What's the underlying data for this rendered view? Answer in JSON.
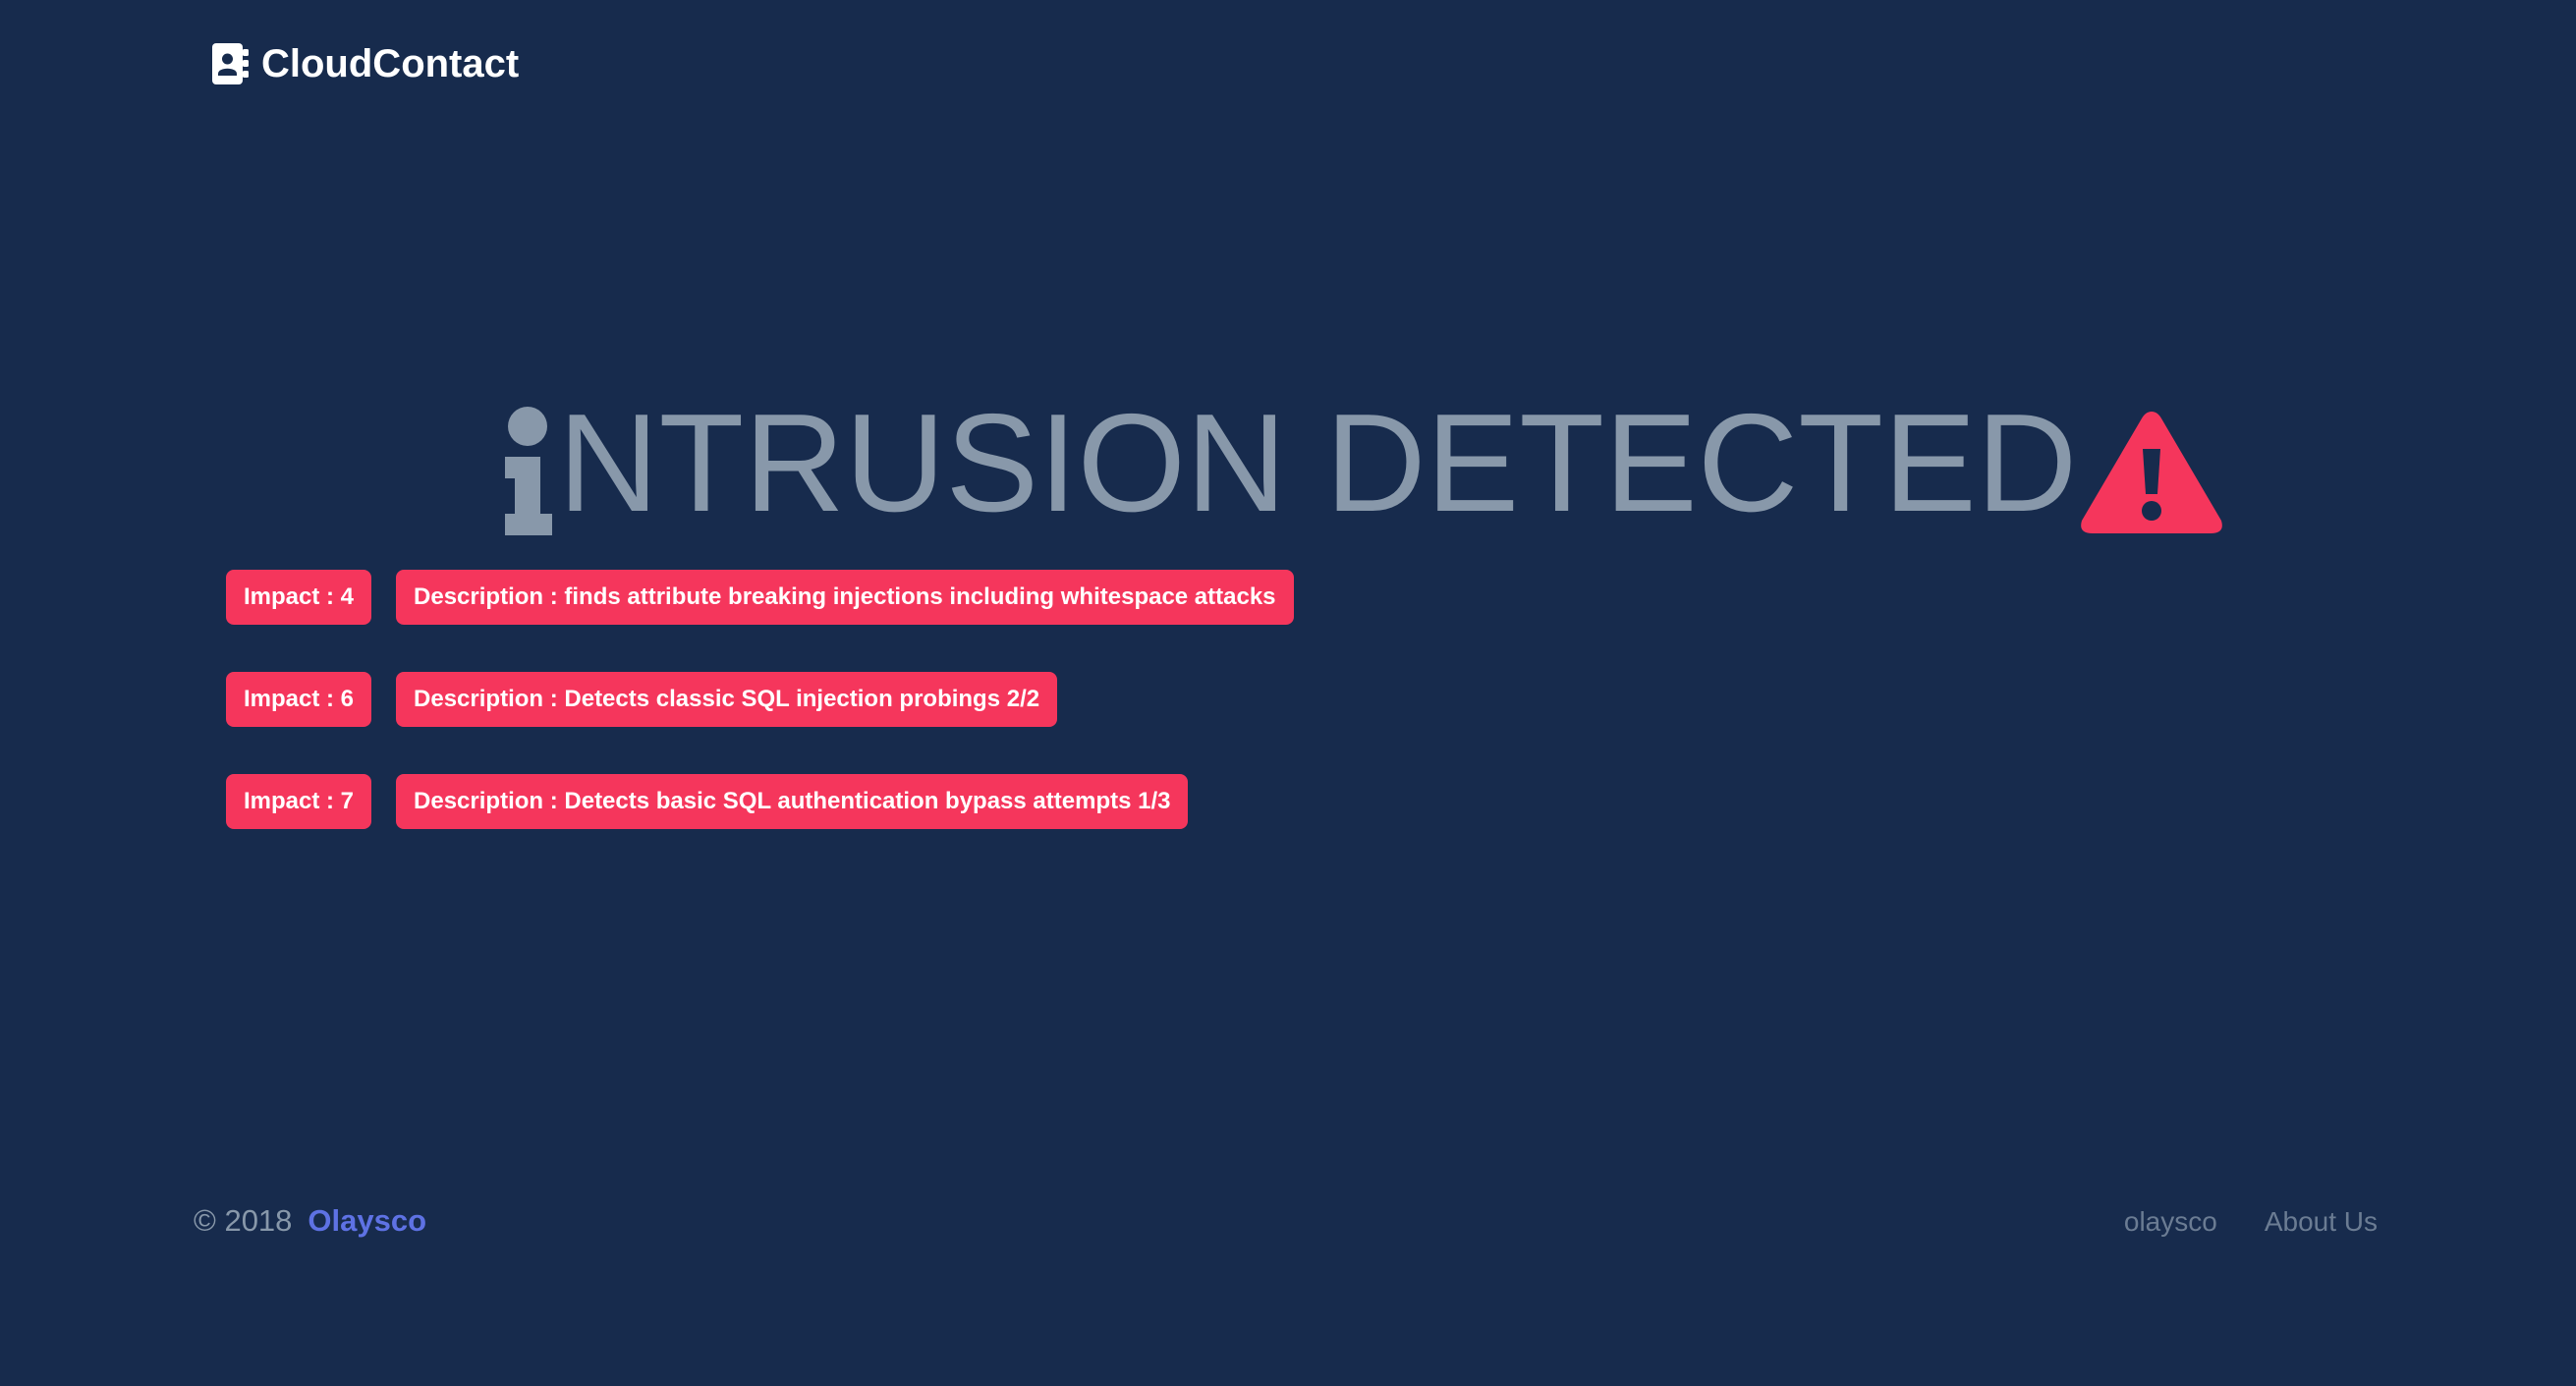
{
  "brand": {
    "icon": "address-book-icon",
    "name": "CloudContact"
  },
  "heading": {
    "icon_left": "info-icon",
    "title": "NTRUSION DETECTED",
    "icon_right": "warning-triangle-icon"
  },
  "alerts": [
    {
      "impact": "Impact : 4",
      "description": "Description : finds attribute breaking injections including whitespace attacks"
    },
    {
      "impact": "Impact : 6",
      "description": "Description : Detects classic SQL injection probings 2/2"
    },
    {
      "impact": "Impact : 7",
      "description": "Description : Detects basic SQL authentication bypass attempts 1/3"
    }
  ],
  "footer": {
    "copyright": "© 2018",
    "company": "Olaysco",
    "links": [
      "olaysco",
      "About Us"
    ]
  },
  "colors": {
    "background": "#172b4d",
    "danger": "#f5365c",
    "muted": "#8898aa",
    "primary": "#5e72e4"
  }
}
